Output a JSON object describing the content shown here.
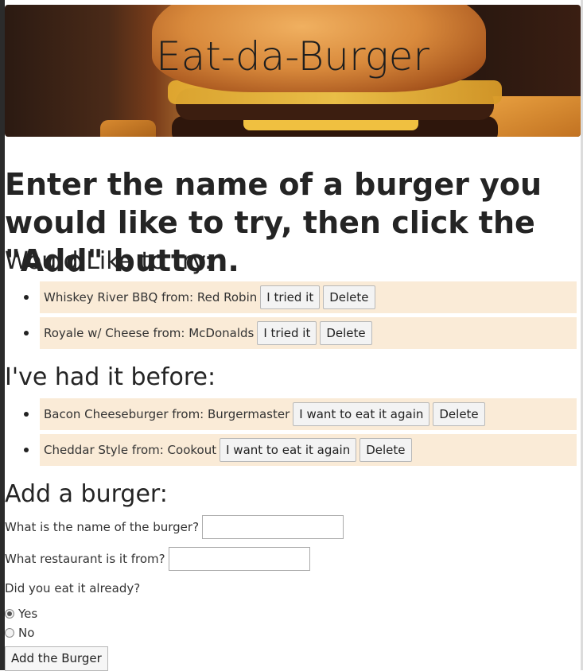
{
  "header": {
    "title": "Eat-da-Burger"
  },
  "intro": {
    "text": "Enter the name of a burger you would like to try, then click the \"Add\" button."
  },
  "would_like": {
    "heading": "Would Like to try:",
    "items": [
      {
        "text": "Whiskey River BBQ from: Red Robin",
        "action_label": "I tried it",
        "delete_label": "Delete"
      },
      {
        "text": "Royale w/ Cheese from: McDonalds",
        "action_label": "I tried it",
        "delete_label": "Delete"
      }
    ]
  },
  "had_before": {
    "heading": "I've had it before:",
    "items": [
      {
        "text": "Bacon Cheeseburger from: Burgermaster",
        "action_label": "I want to eat it again",
        "delete_label": "Delete"
      },
      {
        "text": "Cheddar Style from: Cookout",
        "action_label": "I want to eat it again",
        "delete_label": "Delete"
      }
    ]
  },
  "form": {
    "heading": "Add a burger:",
    "name_label": "What is the name of the burger?",
    "name_value": "",
    "restaurant_label": "What restaurant is it from?",
    "restaurant_value": "",
    "eaten_label": "Did you eat it already?",
    "options": [
      {
        "label": "Yes",
        "checked": true
      },
      {
        "label": "No",
        "checked": false
      }
    ],
    "submit_label": "Add the Burger"
  },
  "colors": {
    "list_bg": "#faebd7"
  },
  "icons": {
    "bullet": "disc-bullet-icon",
    "radio": "radio-icon",
    "hero_image": "burger-photo"
  }
}
